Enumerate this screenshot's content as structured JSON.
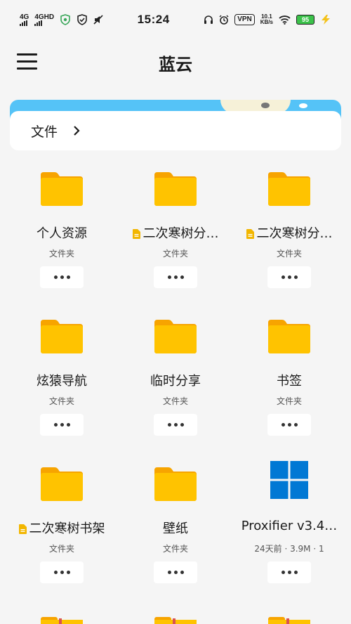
{
  "status_bar": {
    "left_signal_1": "4G",
    "left_signal_2": "4GHD",
    "time": "15:24",
    "vpn": "VPN",
    "speed_value": "10.1",
    "speed_unit": "KB/s",
    "battery": "95",
    "icons": [
      "shield-icon",
      "check-shield-icon",
      "no-sound-icon",
      "headphone-icon",
      "alarm-icon",
      "wifi-icon",
      "charging-icon"
    ]
  },
  "header": {
    "title": "蓝云"
  },
  "breadcrumb": {
    "label": "文件"
  },
  "colors": {
    "folder": "#ffc300",
    "folder_tab": "#f7a400",
    "banner": "#55c3f7",
    "background": "#f5f5f5",
    "windows_blue": "#0078d4"
  },
  "items": [
    {
      "name": "个人资源",
      "meta": "文件夹",
      "icon": "folder-icon",
      "doc_badge": false
    },
    {
      "name": "二次寒树分…",
      "meta": "文件夹",
      "icon": "folder-icon",
      "doc_badge": true
    },
    {
      "name": "二次寒树分…",
      "meta": "文件夹",
      "icon": "folder-icon",
      "doc_badge": true
    },
    {
      "name": "炫猿导航",
      "meta": "文件夹",
      "icon": "folder-icon",
      "doc_badge": false
    },
    {
      "name": "临时分享",
      "meta": "文件夹",
      "icon": "folder-icon",
      "doc_badge": false
    },
    {
      "name": "书签",
      "meta": "文件夹",
      "icon": "folder-icon",
      "doc_badge": false
    },
    {
      "name": "二次寒树书架",
      "meta": "文件夹",
      "icon": "folder-icon",
      "doc_badge": true
    },
    {
      "name": "壁纸",
      "meta": "文件夹",
      "icon": "folder-icon",
      "doc_badge": false
    },
    {
      "name": "Proxifier v3.4…",
      "meta": "24天前 · 3.9M · 1",
      "icon": "windows-icon",
      "doc_badge": false
    }
  ]
}
